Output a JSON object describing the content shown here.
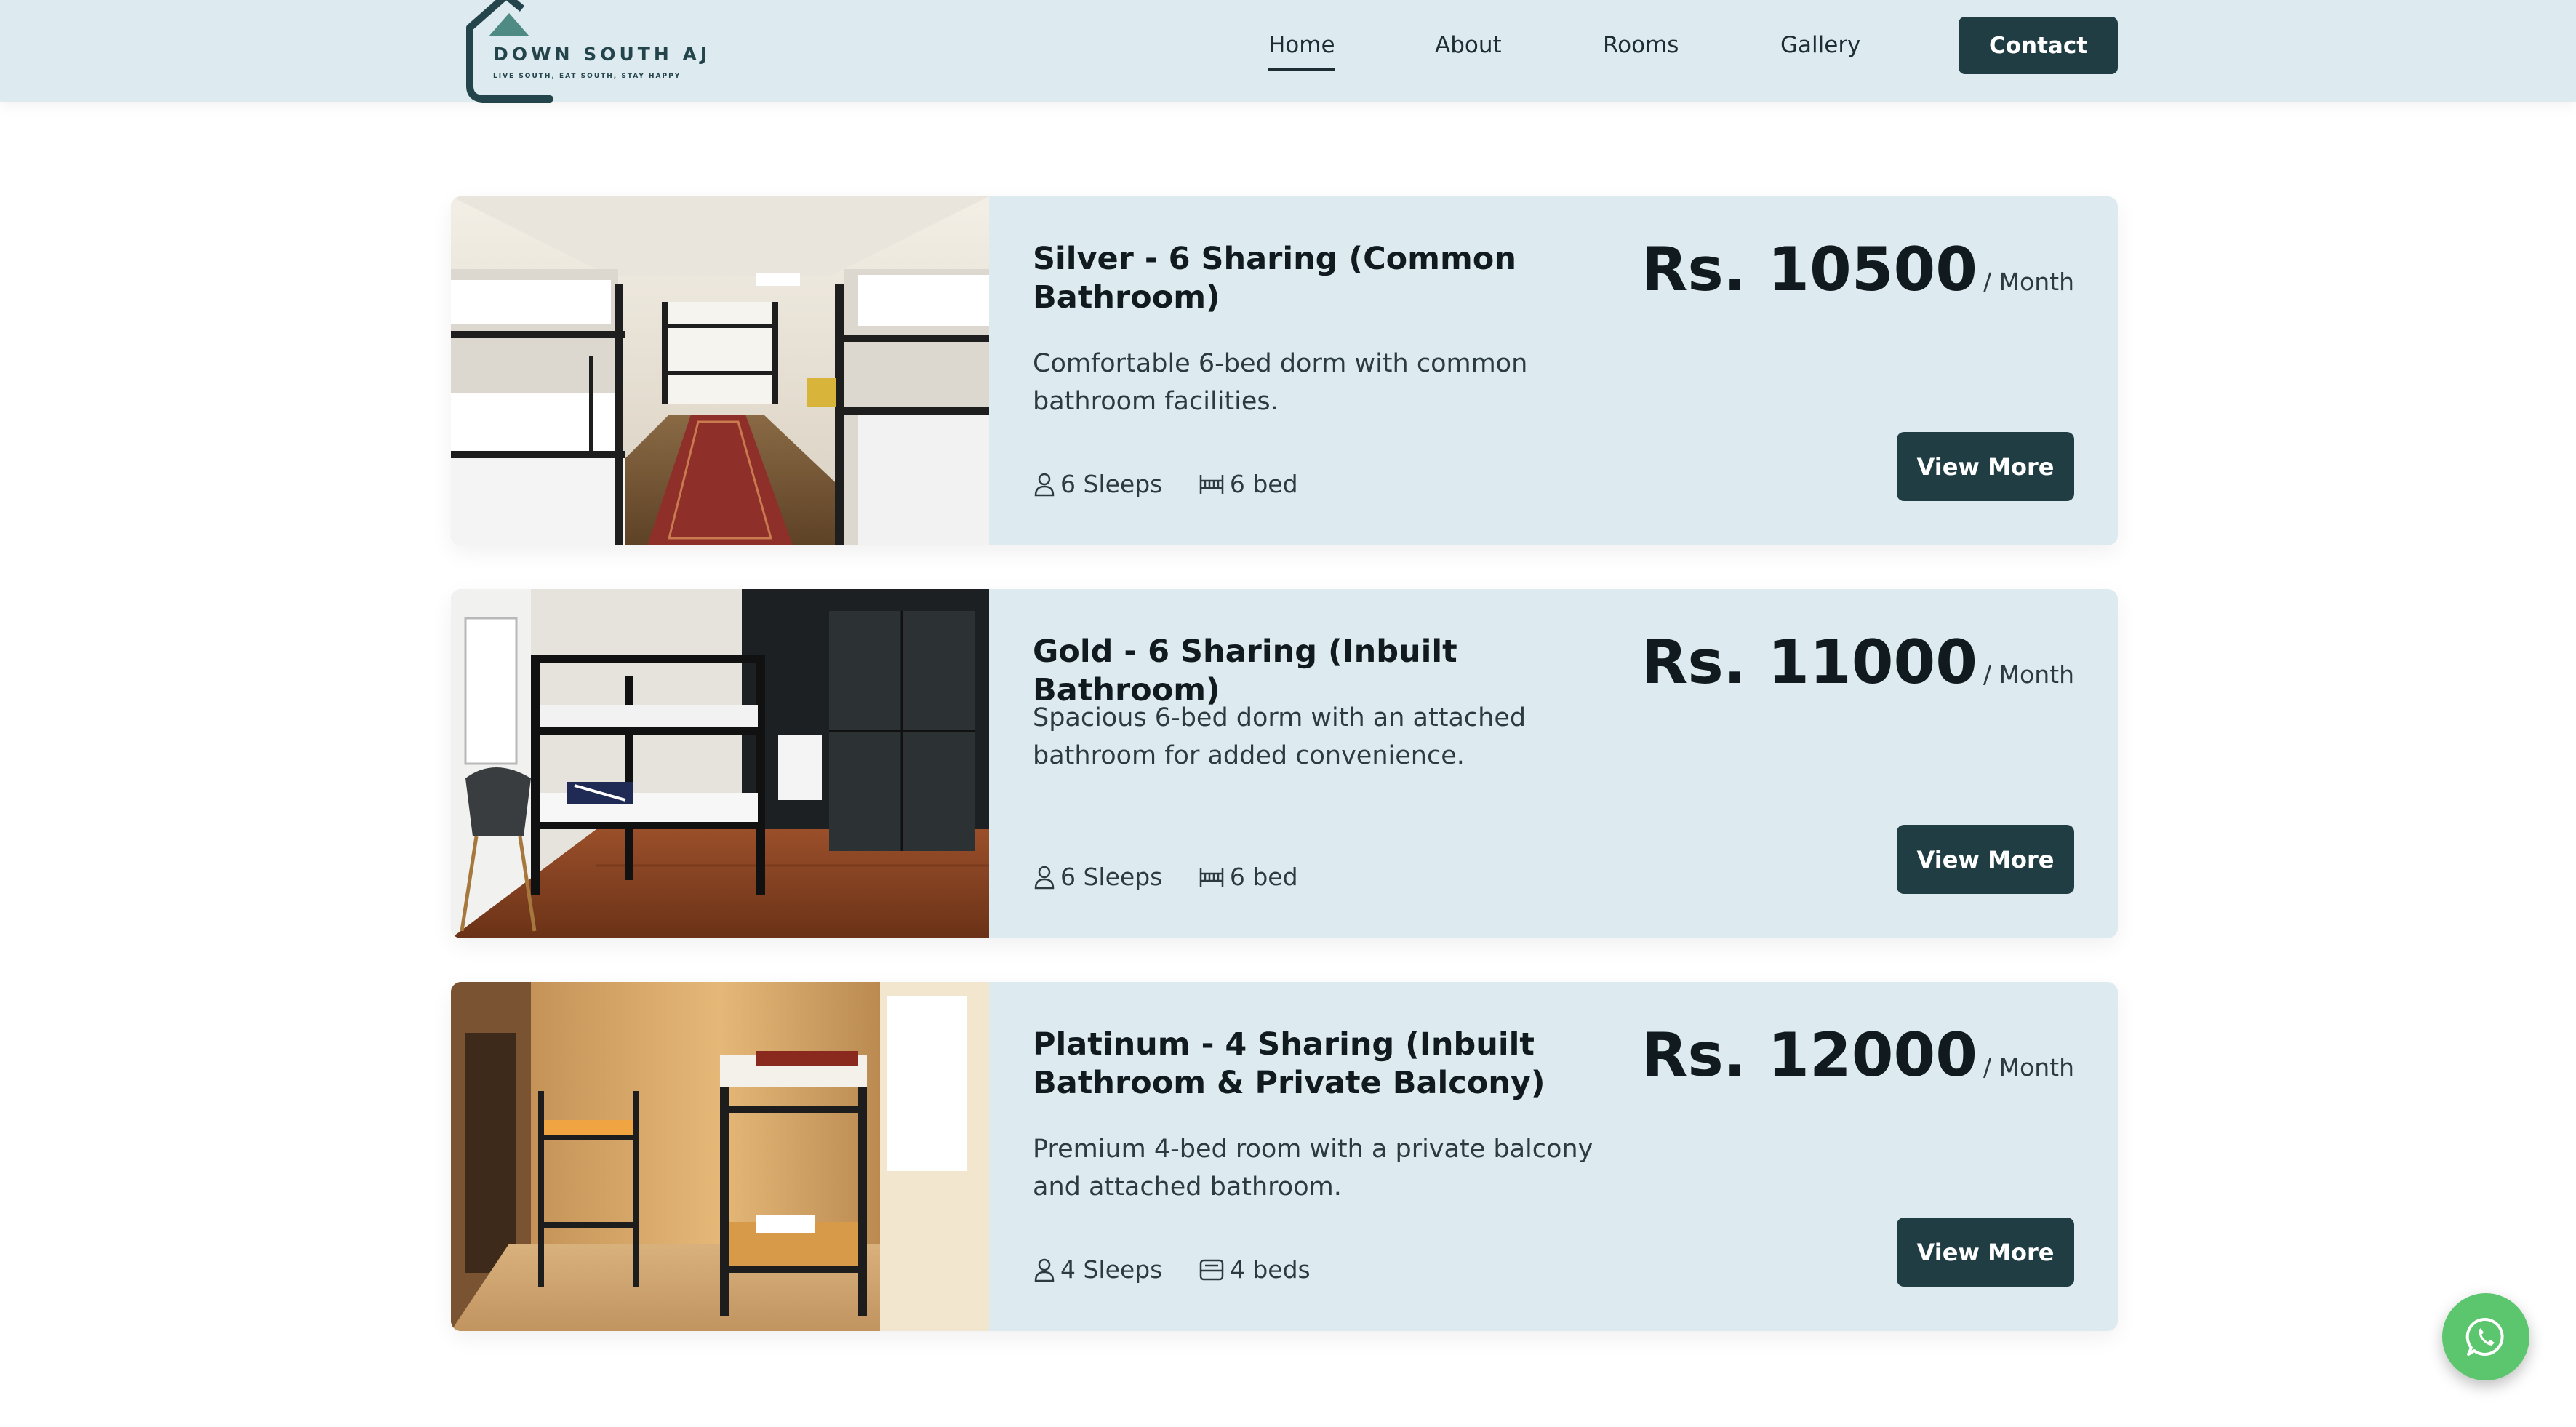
{
  "brand": {
    "name": "DOWN SOUTH AJ",
    "tagline": "LIVE SOUTH, EAT SOUTH, STAY HAPPY"
  },
  "nav": {
    "items": [
      {
        "label": "Home",
        "active": true
      },
      {
        "label": "About",
        "active": false
      },
      {
        "label": "Rooms",
        "active": false
      },
      {
        "label": "Gallery",
        "active": false
      }
    ],
    "contact_label": "Contact"
  },
  "rooms": [
    {
      "title": "Silver - 6 Sharing (Common Bathroom)",
      "description": "Comfortable 6-bed dorm with common bathroom facilities.",
      "sleeps": "6 Sleeps",
      "beds": "6 bed",
      "price": "Rs. 10500",
      "period": "/ Month",
      "button": "View More"
    },
    {
      "title": "Gold - 6 Sharing (Inbuilt Bathroom)",
      "description": "Spacious 6-bed dorm with an attached bathroom for added convenience.",
      "sleeps": "6 Sleeps",
      "beds": "6 bed",
      "price": "Rs. 11000",
      "period": "/ Month",
      "button": "View More"
    },
    {
      "title": "Platinum - 4 Sharing (Inbuilt Bathroom & Private Balcony)",
      "description": "Premium 4-bed room with a private balcony and attached bathroom.",
      "sleeps": "4 Sleeps",
      "beds": "4 beds",
      "price": "Rs. 12000",
      "period": "/ Month",
      "button": "View More"
    }
  ],
  "icons": {
    "whatsapp": "whatsapp-icon",
    "sleeps": "person-icon",
    "beds": "bed-icon"
  },
  "colors": {
    "header_bg": "#ddebf0",
    "card_bg": "#ddebf0",
    "button_bg": "#213d44",
    "whatsapp_bg": "#5cc66e"
  }
}
